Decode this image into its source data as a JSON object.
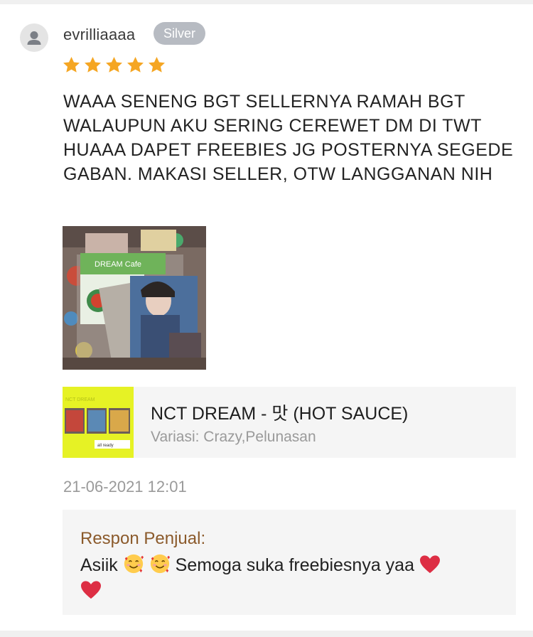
{
  "review": {
    "username": "evrilliaaaa",
    "badge": "Silver",
    "rating": 5,
    "rating_max": 5,
    "star_color": "#f5a623",
    "text": "WAAA SENENG BGT SELLERNYA RAMAH BGT WALAUPUN AKU SERING CEREWET DM DI TWT HUAAA DAPET FREEBIES JG POSTERNYA SEGEDE GABAN. MAKASI SELLER, OTW LANGGANAN NIH",
    "photo_icon": "review-photo"
  },
  "product": {
    "name": "NCT DREAM - 맛 (HOT SAUCE)",
    "variant": "Variasi: Crazy,Pelunasan",
    "thumb_icon": "product-thumbnail"
  },
  "timestamp": "21-06-2021 12:01",
  "seller_response": {
    "label": "Respon Penjual:",
    "text_start": "Asiik",
    "text_middle": "Semoga suka freebiesnya yaa",
    "emoji_icons": [
      "smiling-face-with-hearts-icon",
      "smiling-face-with-hearts-icon",
      "red-heart-icon",
      "red-heart-icon"
    ]
  },
  "colors": {
    "badge_bg": "#b7bbc2",
    "label_brown": "#8b5a2b",
    "panel_bg": "#f5f5f5"
  }
}
